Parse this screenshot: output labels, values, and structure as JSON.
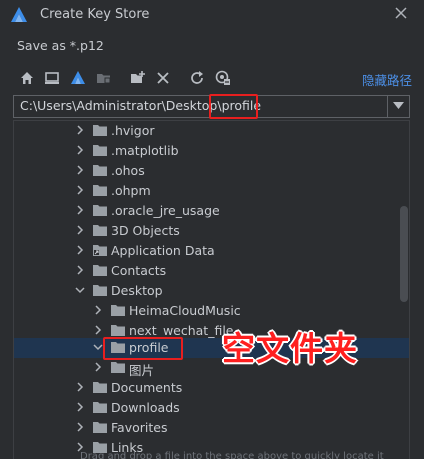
{
  "window": {
    "title": "Create Key Store"
  },
  "save_as": "Save as *.p12",
  "toolbar": {
    "hide_path_label": "隐藏路径"
  },
  "path_field": {
    "prefix": "C:\\Users\\Administrator\\Desktop\\",
    "highlighted": "profile"
  },
  "tree": {
    "items": [
      {
        "label": ".hvigor",
        "expanded": false
      },
      {
        "label": ".matplotlib",
        "expanded": false
      },
      {
        "label": ".ohos",
        "expanded": false
      },
      {
        "label": ".ohpm",
        "expanded": false
      },
      {
        "label": ".oracle_jre_usage",
        "expanded": false
      },
      {
        "label": "3D Objects",
        "expanded": false
      },
      {
        "label": "Application Data",
        "expanded": false
      },
      {
        "label": "Contacts",
        "expanded": false
      },
      {
        "label": "Desktop",
        "expanded": true
      },
      {
        "label": "HeimaCloudMusic",
        "expanded": false
      },
      {
        "label": "next_wechat_file",
        "expanded": false
      },
      {
        "label": "profile",
        "expanded": true,
        "selected": true
      },
      {
        "label": "图片",
        "expanded": false
      },
      {
        "label": "Documents",
        "expanded": false
      },
      {
        "label": "Downloads",
        "expanded": false
      },
      {
        "label": "Favorites",
        "expanded": false
      },
      {
        "label": "Links",
        "expanded": false
      }
    ]
  },
  "annotation": "空文件夹",
  "hint": "Drag and drop a file into the space above to quickly locate it",
  "colors": {
    "accent": "#4c8fe6",
    "selection": "#1f3550",
    "highlight": "#e81f1f",
    "background": "#2b2d30"
  }
}
